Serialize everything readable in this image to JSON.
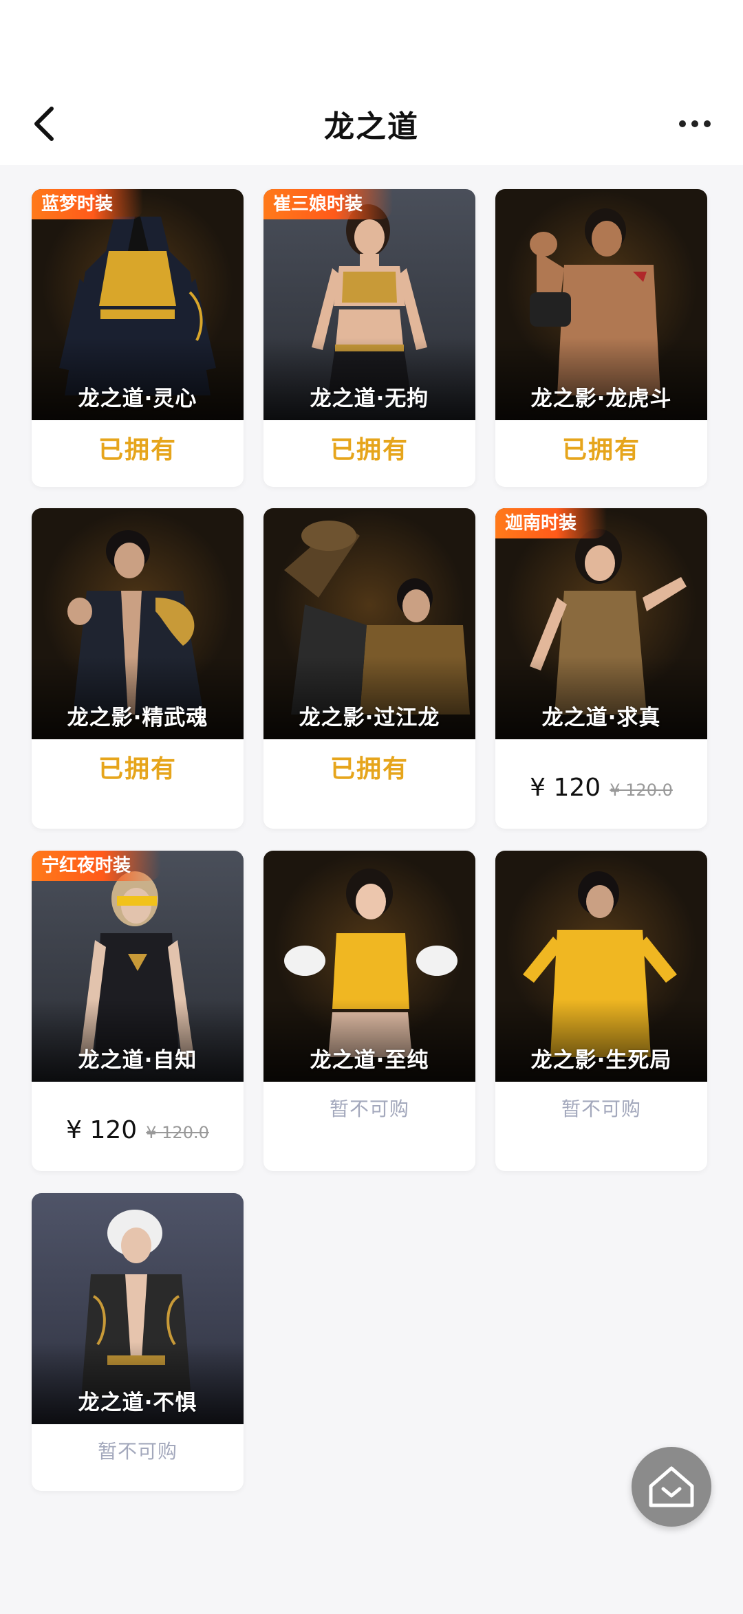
{
  "header": {
    "title": "龙之道"
  },
  "items": [
    {
      "tag": "蓝梦时装",
      "name": "龙之道·灵心",
      "status": "已拥有",
      "theme": "#3b2a16",
      "outfit": "#d9a62a"
    },
    {
      "tag": "崔三娘时装",
      "name": "龙之道·无拘",
      "status": "已拥有",
      "theme": "#3a3d45",
      "outfit": "#c89a38"
    },
    {
      "tag": "",
      "name": "龙之影·龙虎斗",
      "status": "已拥有",
      "theme": "#3b2a16",
      "outfit": "#b07852"
    },
    {
      "tag": "",
      "name": "龙之影·精武魂",
      "status": "已拥有",
      "theme": "#3b2a16",
      "outfit": "#1f2430"
    },
    {
      "tag": "",
      "name": "龙之影·过江龙",
      "status": "已拥有",
      "theme": "#3b2a16",
      "outfit": "#7a5a2a"
    },
    {
      "tag": "迦南时装",
      "name": "龙之道·求真",
      "price": "¥ 120",
      "old_price": "¥ 120.0",
      "theme": "#3b2a16",
      "outfit": "#8a6a3e"
    },
    {
      "tag": "宁红夜时装",
      "name": "龙之道·自知",
      "price": "¥ 120",
      "old_price": "¥ 120.0",
      "theme": "#3a3d45",
      "outfit": "#1d1d22"
    },
    {
      "tag": "",
      "name": "龙之道·至纯",
      "unavailable": "暂不可购",
      "theme": "#3b2a16",
      "outfit": "#f0b722"
    },
    {
      "tag": "",
      "name": "龙之影·生死局",
      "unavailable": "暂不可购",
      "theme": "#3b2a16",
      "outfit": "#f0b722"
    },
    {
      "tag": "",
      "name": "龙之道·不惧",
      "unavailable": "暂不可购",
      "theme": "#3d4152",
      "outfit": "#2a2a2a"
    }
  ],
  "icons": {
    "back": "chevron-left-icon",
    "more": "more-dots-icon",
    "home": "home-icon"
  }
}
